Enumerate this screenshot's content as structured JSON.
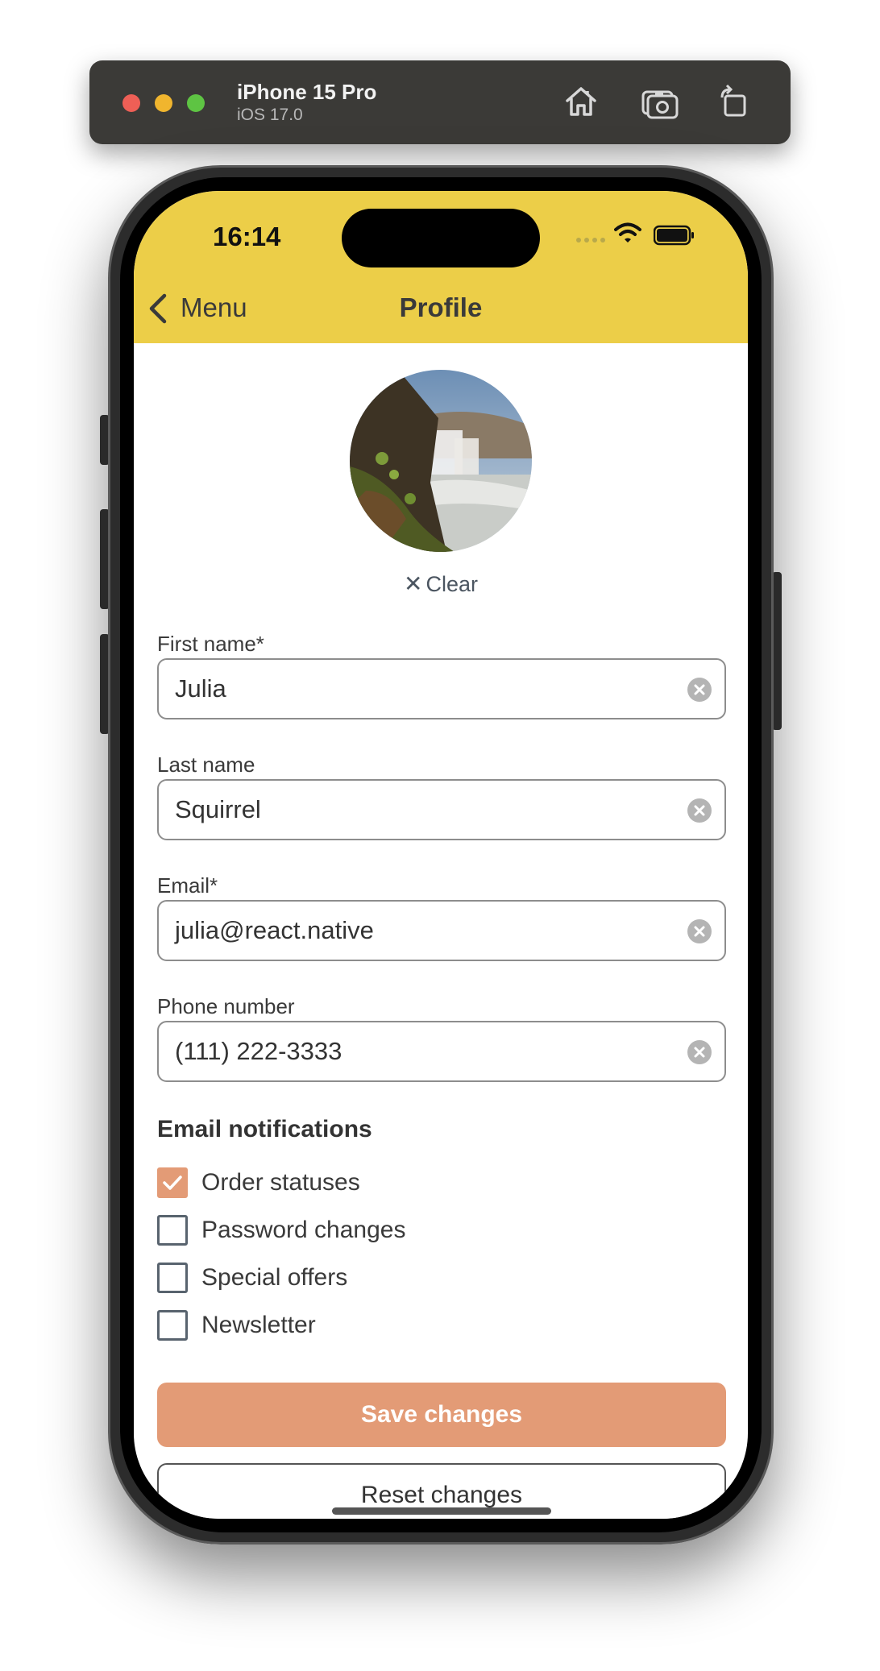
{
  "simulator": {
    "device_name": "iPhone 15 Pro",
    "os_version": "iOS 17.0",
    "buttons": [
      "home-icon",
      "screenshot-icon",
      "rotate-icon"
    ]
  },
  "status_bar": {
    "time": "16:14"
  },
  "nav": {
    "back_label": "Menu",
    "title": "Profile"
  },
  "avatar": {
    "clear_label": "Clear"
  },
  "form": {
    "fields": [
      {
        "label": "First name*",
        "value": "Julia"
      },
      {
        "label": "Last name",
        "value": "Squirrel"
      },
      {
        "label": "Email*",
        "value": "julia@react.native"
      },
      {
        "label": "Phone number",
        "value": "(111) 222-3333"
      }
    ]
  },
  "notifications": {
    "title": "Email notifications",
    "options": [
      {
        "label": "Order statuses",
        "checked": true
      },
      {
        "label": "Password changes",
        "checked": false
      },
      {
        "label": "Special offers",
        "checked": false
      },
      {
        "label": "Newsletter",
        "checked": false
      }
    ]
  },
  "actions": {
    "save_label": "Save changes",
    "reset_label": "Reset changes"
  },
  "colors": {
    "header_bg": "#ecce48",
    "accent": "#e39b76",
    "toolbar_bg": "#3b3a37"
  }
}
